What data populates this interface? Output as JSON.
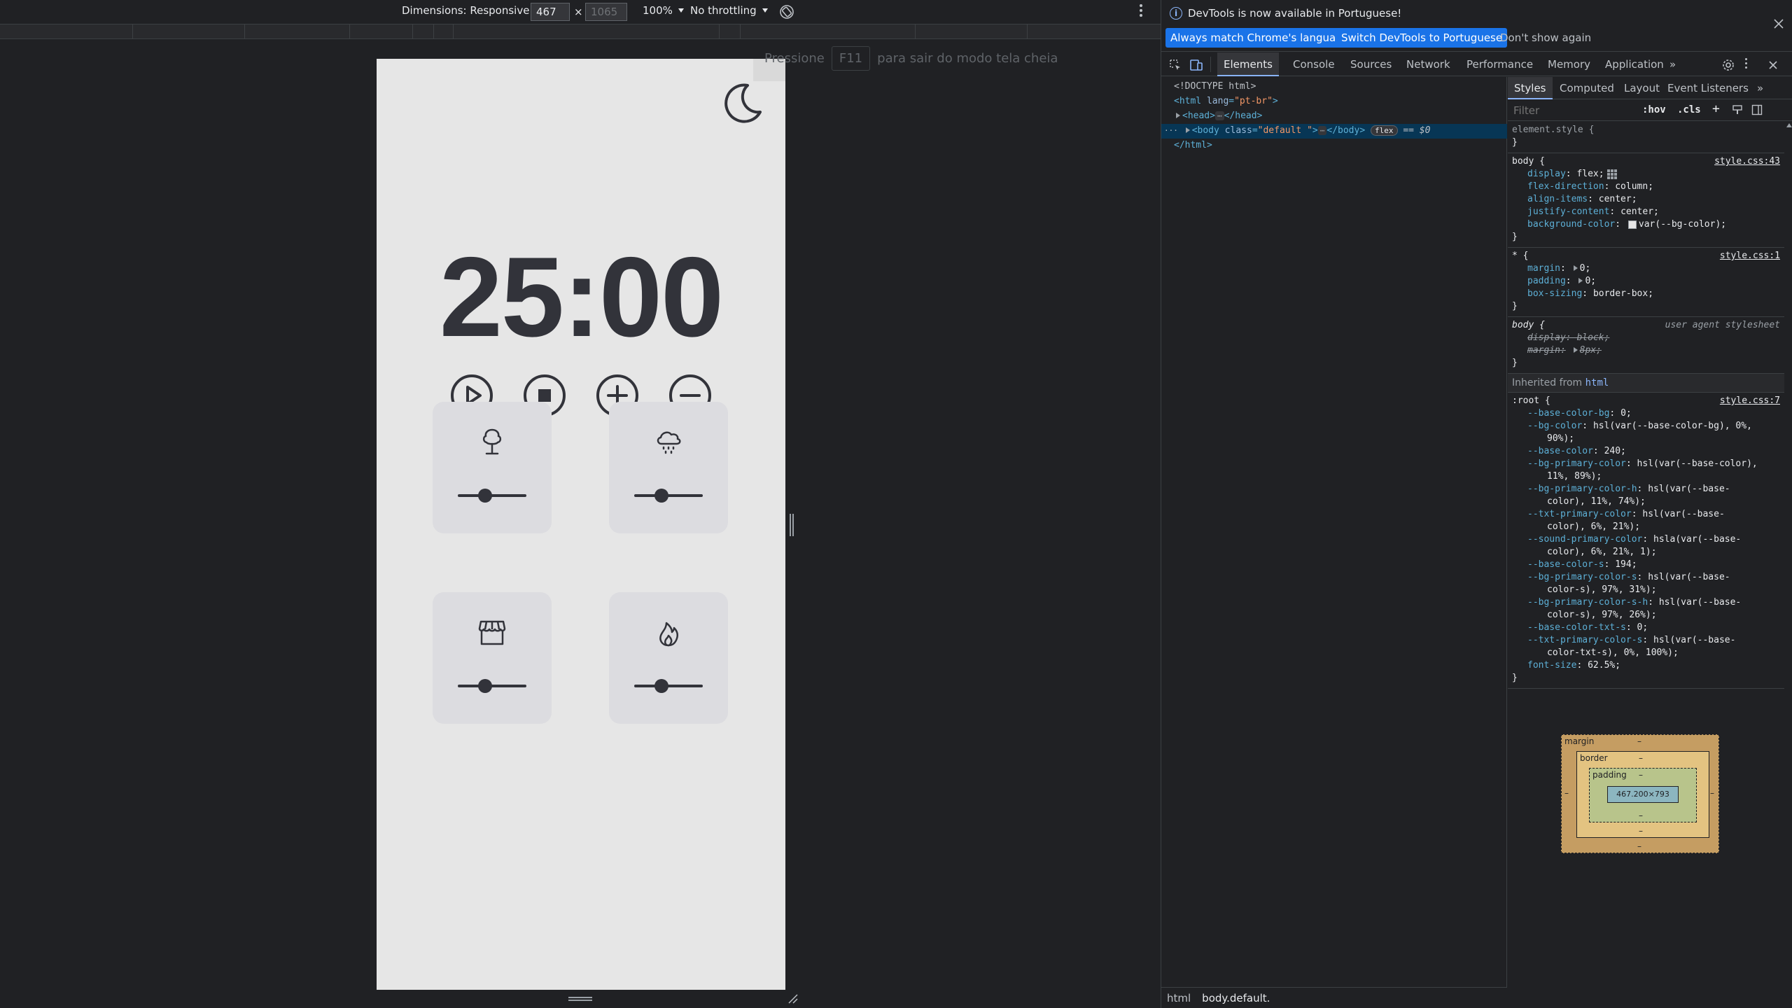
{
  "device_toolbar": {
    "dimensions_label": "Dimensions: Responsive",
    "width_value": "467",
    "height_placeholder": "1065",
    "times": "×",
    "zoom": "100%",
    "throttling": "No throttling"
  },
  "fullscreen_hint": {
    "before": "Pressione",
    "key": "F11",
    "after": "para sair do modo tela cheia"
  },
  "app": {
    "timer": "25:00",
    "sounds": [
      {
        "name": "tree-icon",
        "volume": 0.3
      },
      {
        "name": "cloud-rain-icon",
        "volume": 0.3
      },
      {
        "name": "store-icon",
        "volume": 0.3
      },
      {
        "name": "fire-icon",
        "volume": 0.3
      }
    ],
    "colors": {
      "bg": "#e6e6e6",
      "card": "#dcdce0",
      "ink": "#32333a"
    }
  },
  "devtools": {
    "infobar": {
      "message": "DevTools is now available in Portuguese!",
      "btn_match": "Always match Chrome's language",
      "btn_switch": "Switch DevTools to Portuguese",
      "btn_dismiss": "Don't show again"
    },
    "tabs": [
      "Elements",
      "Console",
      "Sources",
      "Network",
      "Performance",
      "Memory",
      "Application"
    ],
    "elements": {
      "doctype": "<!DOCTYPE html>",
      "html_open_tag": "<html",
      "html_lang_attr": "lang",
      "html_lang_val": "\"pt-br\"",
      "html_open_close": ">",
      "head_open": "<head>",
      "head_close": "</head>",
      "body_open": "<body",
      "body_class_attr": "class",
      "body_class_val": "\"default \"",
      "body_open_close": ">",
      "body_close": "</body>",
      "flex_badge": "flex",
      "selected_marker": "== $0",
      "html_close": "</html>",
      "ellipsis": "⋯",
      "gutter_dots": "···"
    },
    "breadcrumbs": [
      "html",
      "body.default."
    ],
    "styles_tabs": [
      "Styles",
      "Computed",
      "Layout",
      "Event Listeners"
    ],
    "filter_placeholder": "Filter",
    "filter_hov": ":hov",
    "filter_cls": ".cls",
    "rules": {
      "element_style": "element.style {",
      "close": "}",
      "body_sel": "body {",
      "body_src": "style.css:43",
      "body_display_name": "display",
      "body_display_val": "flex;",
      "body_fd_name": "flex-direction",
      "body_fd_val": "column;",
      "body_ai_name": "align-items",
      "body_ai_val": "center;",
      "body_jc_name": "justify-content",
      "body_jc_val": "center;",
      "body_bg_name": "background-color",
      "body_bg_val": "var(--bg-color);",
      "star_sel": "* {",
      "star_src": "style.css:1",
      "star_margin_name": "margin",
      "star_margin_val": "0;",
      "star_padding_name": "padding",
      "star_padding_val": "0;",
      "star_bs_name": "box-sizing",
      "star_bs_val": "border-box;",
      "ua_sel": "body {",
      "ua_src": "user agent stylesheet",
      "ua_display": "display: block;",
      "ua_margin_name": "margin:",
      "ua_margin_val": "8px;",
      "inherited_label": "Inherited from",
      "inherited_link": "html",
      "root_sel": ":root {",
      "root_src": "style.css:7",
      "root_lines": [
        [
          "--base-color-bg",
          "0;"
        ],
        [
          "--bg-color",
          "hsl(var(--base-color-bg), 0%,"
        ],
        [
          "",
          "90%);"
        ],
        [
          "--base-color",
          "240;"
        ],
        [
          "--bg-primary-color",
          "hsl(var(--base-color),"
        ],
        [
          "",
          "11%, 89%);"
        ],
        [
          "--bg-primary-color-h",
          "hsl(var(--base-"
        ],
        [
          "",
          "color), 11%, 74%);"
        ],
        [
          "--txt-primary-color",
          "hsl(var(--base-"
        ],
        [
          "",
          "color), 6%, 21%);"
        ],
        [
          "--sound-primary-color",
          "hsla(var(--base-"
        ],
        [
          "",
          "color), 6%, 21%, 1);"
        ],
        [
          "--base-color-s",
          "194;"
        ],
        [
          "--bg-primary-color-s",
          "hsl(var(--base-"
        ],
        [
          "",
          "color-s), 97%, 31%);"
        ],
        [
          "--bg-primary-color-s-h",
          "hsl(var(--base-"
        ],
        [
          "",
          "color-s), 97%, 26%);"
        ],
        [
          "--base-color-txt-s",
          "0;"
        ],
        [
          "--txt-primary-color-s",
          "hsl(var(--base-"
        ],
        [
          "",
          "color-txt-s), 0%, 100%);"
        ],
        [
          "font-size",
          "62.5%;"
        ]
      ]
    },
    "box_model": {
      "margin": "margin",
      "border": "border",
      "padding": "padding",
      "dash": "–",
      "content": "467.200×793"
    }
  }
}
